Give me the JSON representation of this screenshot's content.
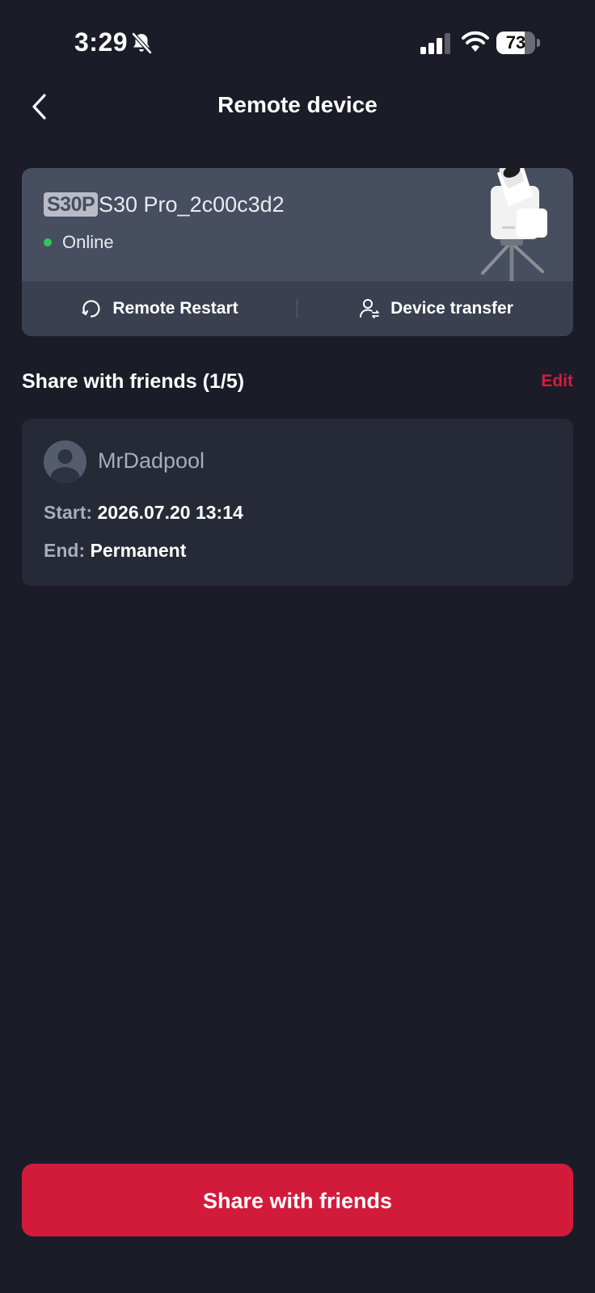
{
  "status_bar": {
    "time": "3:29",
    "battery": "73",
    "battery_level": 0.73,
    "icons": [
      "bell-slash-icon",
      "cellular-signal-icon",
      "wifi-icon",
      "battery-icon"
    ]
  },
  "nav": {
    "title": "Remote device",
    "back_icon": "chevron-left-icon"
  },
  "device": {
    "badge": "S30P",
    "name": "S30 Pro_2c00c3d2",
    "status": "Online",
    "status_color": "#33c759",
    "actions": {
      "restart": "Remote Restart",
      "transfer": "Device transfer"
    }
  },
  "share": {
    "title": "Share with friends (1/5)",
    "edit": "Edit",
    "friends": [
      {
        "name": "MrDadpool",
        "start_label": "Start:",
        "start": "2026.07.20 13:14",
        "end_label": "End:",
        "end": "Permanent"
      }
    ]
  },
  "footer": {
    "button": "Share with friends",
    "accent": "#d21b3a"
  }
}
